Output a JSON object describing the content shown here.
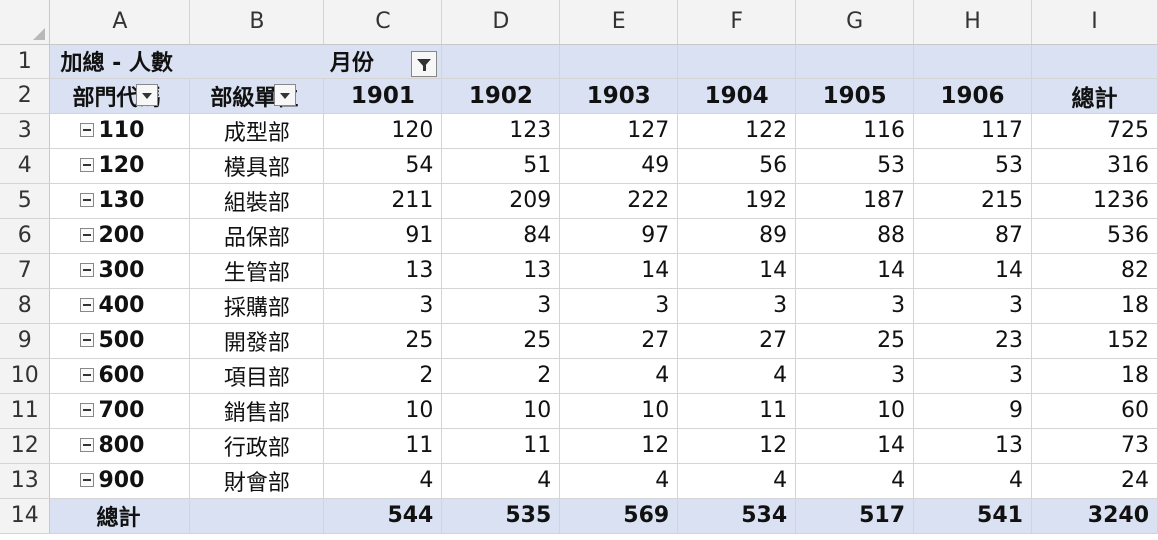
{
  "columns": [
    "A",
    "B",
    "C",
    "D",
    "E",
    "F",
    "G",
    "H",
    "I"
  ],
  "pivot": {
    "value_label": "加總 - 人數",
    "column_field_label": "月份",
    "row_field_1": "部門代碼",
    "row_field_2": "部級單位",
    "months": [
      "1901",
      "1902",
      "1903",
      "1904",
      "1905",
      "1906"
    ],
    "total_header": "總計",
    "rows": [
      {
        "row": "3",
        "code": "110",
        "unit": "成型部",
        "values": [
          "120",
          "123",
          "127",
          "122",
          "116",
          "117"
        ],
        "total": "725"
      },
      {
        "row": "4",
        "code": "120",
        "unit": "模具部",
        "values": [
          "54",
          "51",
          "49",
          "56",
          "53",
          "53"
        ],
        "total": "316"
      },
      {
        "row": "5",
        "code": "130",
        "unit": "組裝部",
        "values": [
          "211",
          "209",
          "222",
          "192",
          "187",
          "215"
        ],
        "total": "1236"
      },
      {
        "row": "6",
        "code": "200",
        "unit": "品保部",
        "values": [
          "91",
          "84",
          "97",
          "89",
          "88",
          "87"
        ],
        "total": "536"
      },
      {
        "row": "7",
        "code": "300",
        "unit": "生管部",
        "values": [
          "13",
          "13",
          "14",
          "14",
          "14",
          "14"
        ],
        "total": "82"
      },
      {
        "row": "8",
        "code": "400",
        "unit": "採購部",
        "values": [
          "3",
          "3",
          "3",
          "3",
          "3",
          "3"
        ],
        "total": "18"
      },
      {
        "row": "9",
        "code": "500",
        "unit": "開發部",
        "values": [
          "25",
          "25",
          "27",
          "27",
          "25",
          "23"
        ],
        "total": "152"
      },
      {
        "row": "10",
        "code": "600",
        "unit": "項目部",
        "values": [
          "2",
          "2",
          "4",
          "4",
          "3",
          "3"
        ],
        "total": "18"
      },
      {
        "row": "11",
        "code": "700",
        "unit": "銷售部",
        "values": [
          "10",
          "10",
          "10",
          "11",
          "10",
          "9"
        ],
        "total": "60"
      },
      {
        "row": "12",
        "code": "800",
        "unit": "行政部",
        "values": [
          "11",
          "11",
          "12",
          "12",
          "14",
          "13"
        ],
        "total": "73"
      },
      {
        "row": "13",
        "code": "900",
        "unit": "財會部",
        "values": [
          "4",
          "4",
          "4",
          "4",
          "4",
          "4"
        ],
        "total": "24"
      }
    ],
    "grand_total": {
      "row": "14",
      "label": "總計",
      "values": [
        "544",
        "535",
        "569",
        "534",
        "517",
        "541"
      ],
      "total": "3240"
    }
  },
  "row_numbers": {
    "r1": "1",
    "r2": "2"
  },
  "colors": {
    "band": "#d9e1f2",
    "header_bg": "#f3f3f3"
  },
  "icons": {
    "collapse": "minus-box-icon",
    "dropdown": "dropdown-arrow-icon",
    "filter": "filter-icon"
  }
}
